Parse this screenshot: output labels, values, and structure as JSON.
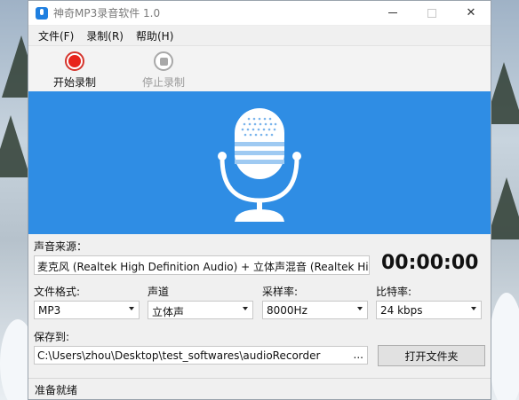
{
  "window": {
    "title": "神奇MP3录音软件 1.0",
    "controls": {
      "minimize": "—",
      "close": "✕"
    }
  },
  "menu": [
    {
      "label": "文件(F)"
    },
    {
      "label": "录制(R)"
    },
    {
      "label": "帮助(H)"
    }
  ],
  "toolbar": {
    "start_label": "开始录制",
    "stop_label": "停止录制",
    "stop_enabled": false
  },
  "banner": {
    "color": "#2f8de4",
    "icon": "microphone-icon"
  },
  "form": {
    "source_label": "声音来源：",
    "source_value": "麦克风 (Realtek High Definition Audio) + 立体声混音 (Realtek Hig ...",
    "timer": "00:00:00",
    "format_label": "文件格式:",
    "format_value": "MP3",
    "channel_label": "声道",
    "channel_value": "立体声",
    "samplerate_label": "采样率:",
    "samplerate_value": "8000Hz",
    "bitrate_label": "比特率:",
    "bitrate_value": "24 kbps",
    "saveto_label": "保存到:",
    "saveto_value": "C:\\Users\\zhou\\Desktop\\test_softwares\\audioRecorder",
    "browse_label": "...",
    "open_folder_label": "打开文件夹"
  },
  "status": {
    "text": "准备就绪"
  },
  "colors": {
    "accent": "#2f8de4",
    "record_red": "#e8231b"
  }
}
